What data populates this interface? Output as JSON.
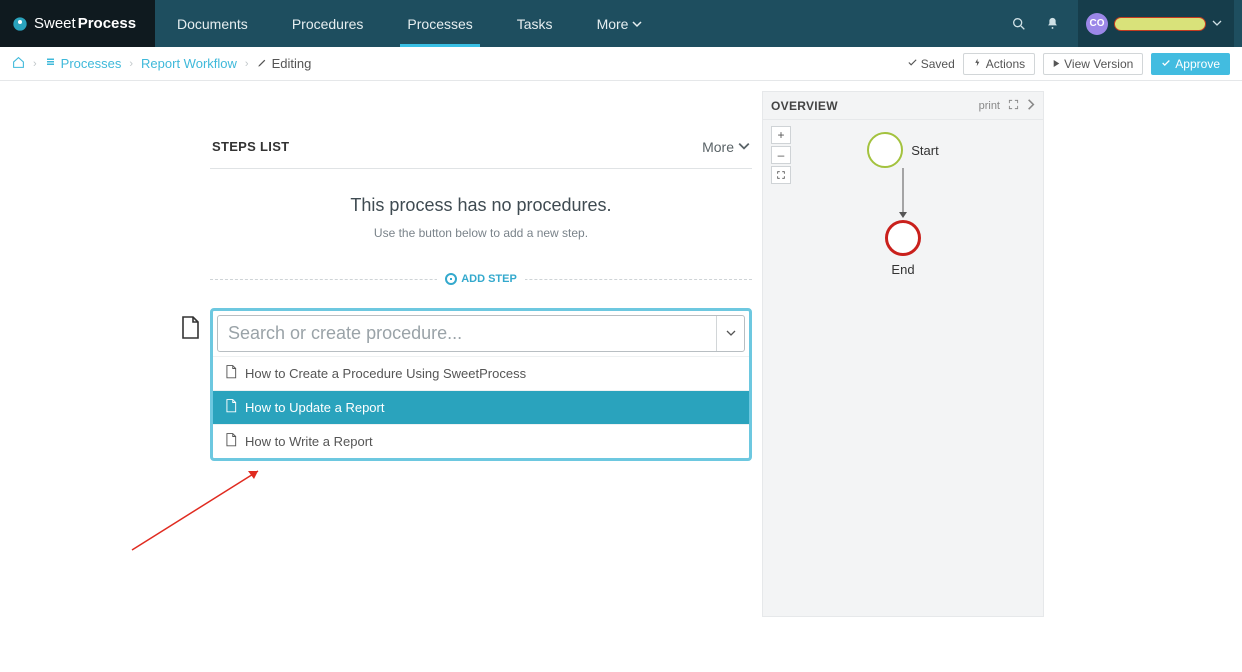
{
  "brand": {
    "light": "Sweet",
    "bold": "Process"
  },
  "nav": {
    "documents": "Documents",
    "procedures": "Procedures",
    "processes": "Processes",
    "tasks": "Tasks",
    "more": "More"
  },
  "user": {
    "initials": "CO"
  },
  "breadcrumb": {
    "processes": "Processes",
    "workflow": "Report Workflow",
    "editing": "Editing"
  },
  "subheader": {
    "saved": "Saved",
    "actions": "Actions",
    "view_version": "View Version",
    "approve": "Approve"
  },
  "steps": {
    "title": "STEPS LIST",
    "more": "More",
    "empty_title": "This process has no procedures.",
    "empty_sub": "Use the button below to add a new step.",
    "add_step": "ADD STEP",
    "search_placeholder": "Search or create procedure...",
    "options": [
      "How to Create a Procedure Using SweetProcess",
      "How to Update a Report",
      "How to Write a Report"
    ]
  },
  "overview": {
    "title": "OVERVIEW",
    "print": "print",
    "zoom_in": "+",
    "zoom_out": "–",
    "start": "Start",
    "end": "End"
  }
}
